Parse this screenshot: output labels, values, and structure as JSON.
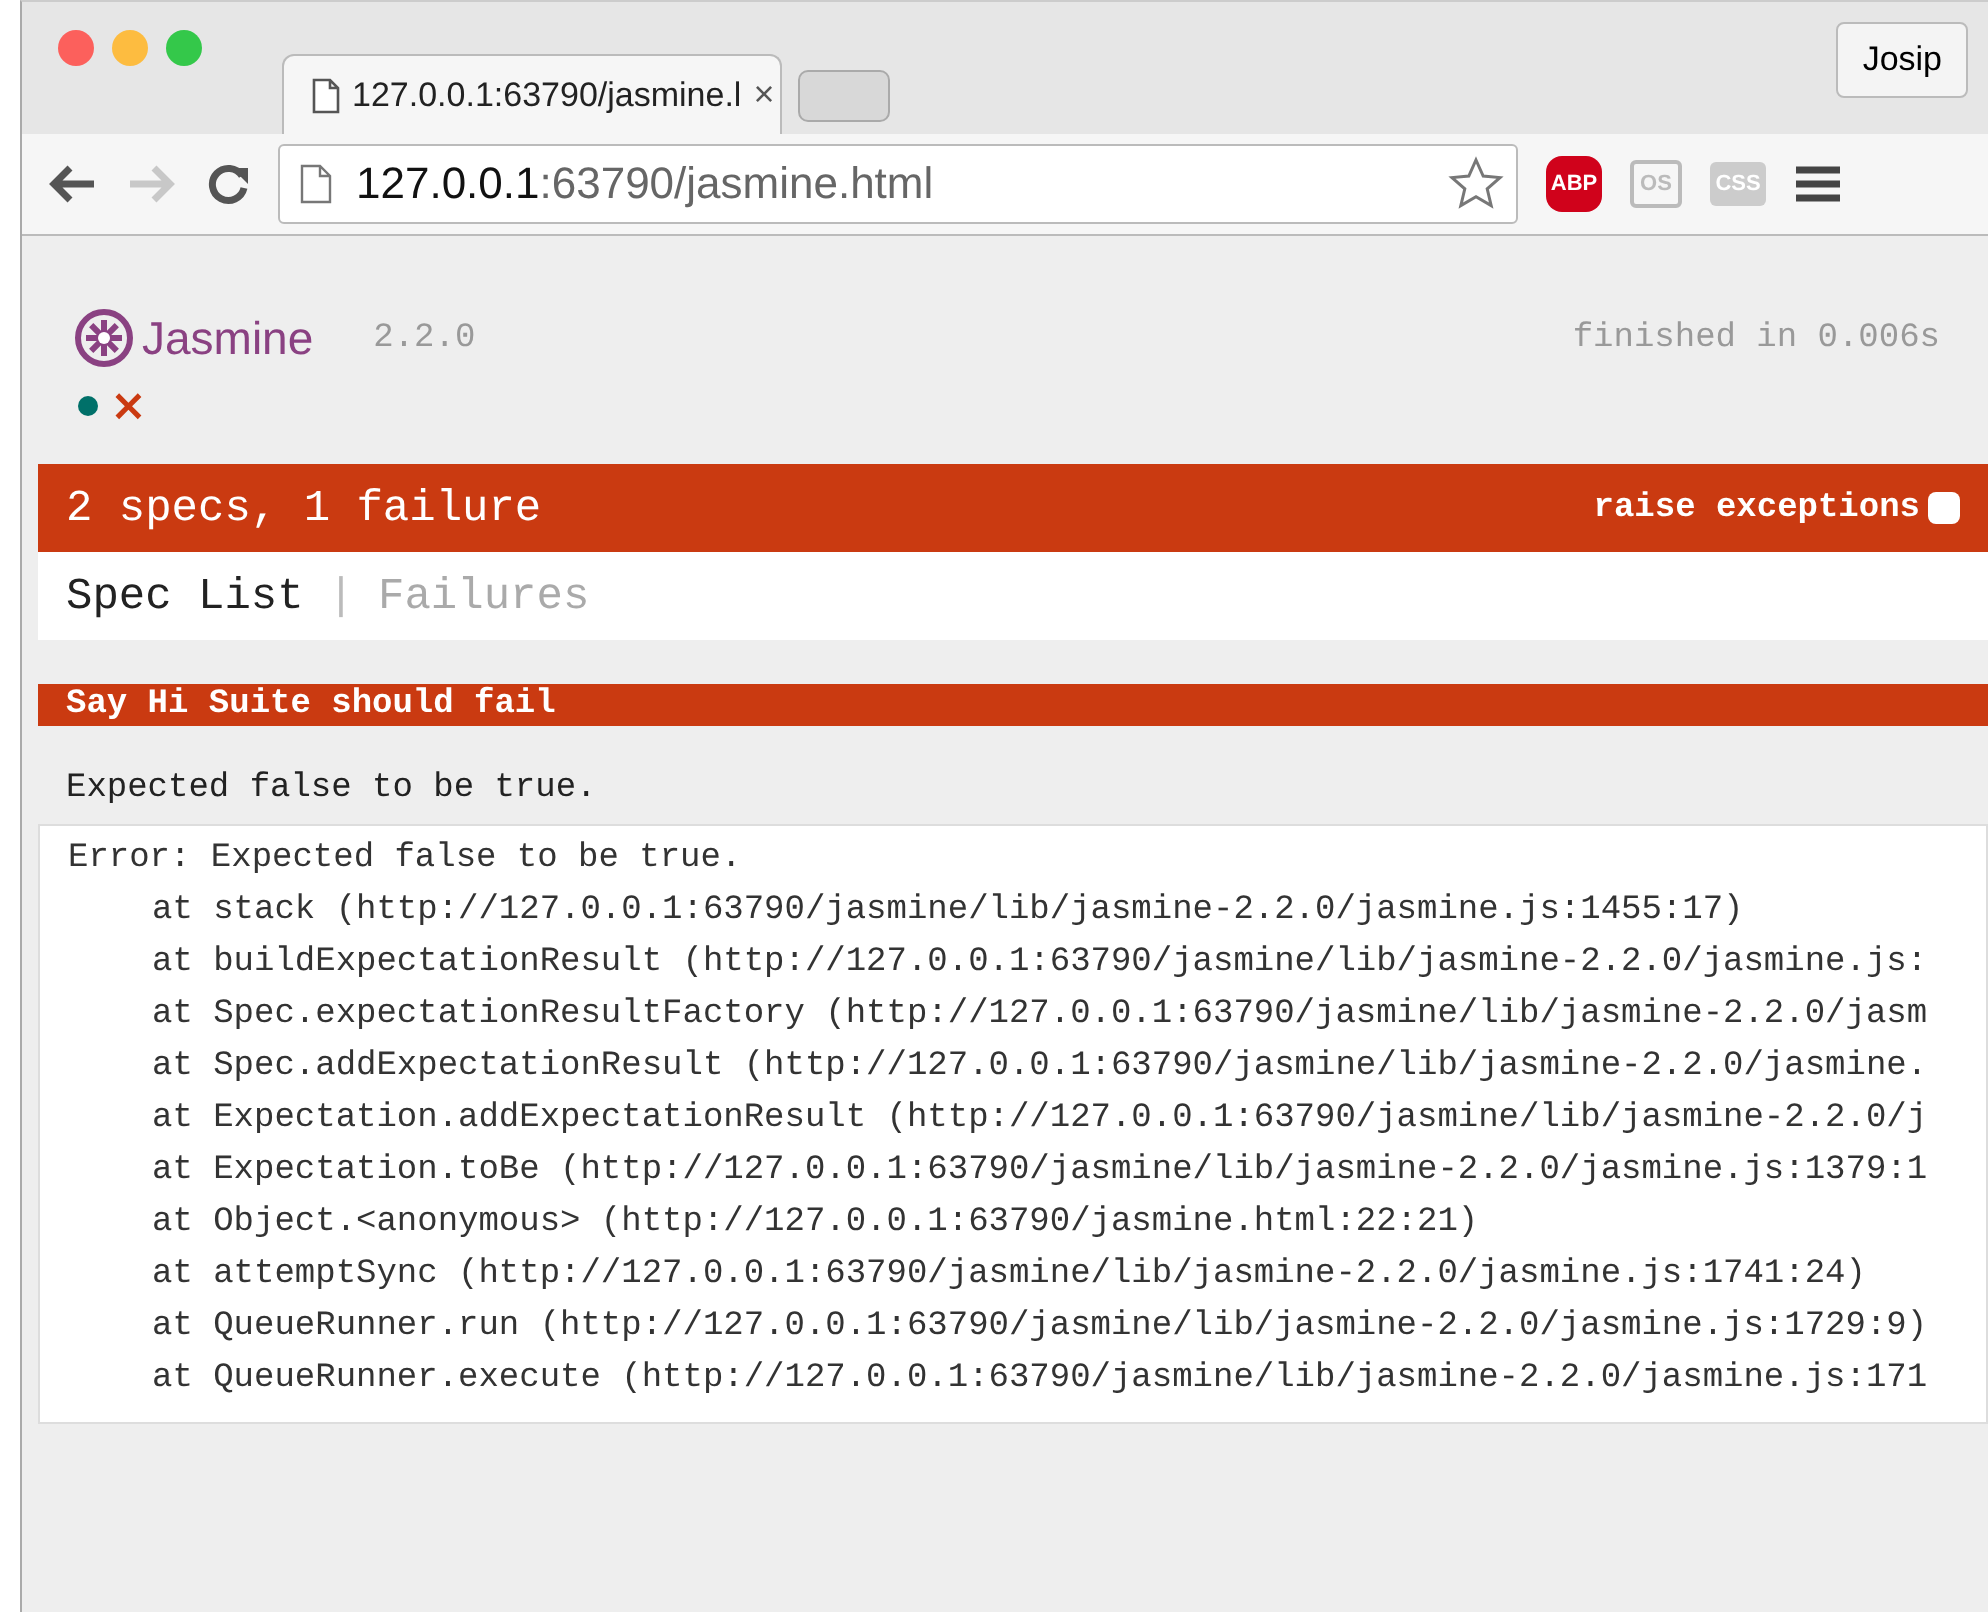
{
  "browser": {
    "tabs": [
      {
        "title": "127.0.0.1:63790/jasmine.l",
        "close": "×",
        "selected": true
      }
    ],
    "profile": "Josip",
    "address": {
      "host": "127.0.0.1",
      "rest": ":63790/jasmine.html"
    },
    "extensions": [
      {
        "kind": "abp",
        "label": "ABP"
      },
      {
        "kind": "box",
        "label": "OS"
      },
      {
        "kind": "css",
        "label": "CSS"
      }
    ]
  },
  "reporter": {
    "brand": "Jasmine",
    "version": "2.2.0",
    "duration": "finished in 0.006s",
    "symbols": [
      {
        "kind": "passed"
      },
      {
        "kind": "failed",
        "glyph": "×"
      }
    ],
    "summary": "2 specs, 1 failure",
    "raise_exceptions": {
      "label": "raise exceptions",
      "checked": false
    },
    "menu": [
      {
        "label": "Spec List",
        "selected": true
      },
      {
        "label": "Failures",
        "selected": false
      }
    ],
    "separator": "|",
    "failures": [
      {
        "title": "Say Hi Suite should fail",
        "message": "Expected false to be true.",
        "stack": [
          "Error: Expected false to be true.",
          "at stack (http://127.0.0.1:63790/jasmine/lib/jasmine-2.2.0/jasmine.js:1455:17)",
          "at buildExpectationResult (http://127.0.0.1:63790/jasmine/lib/jasmine-2.2.0/jasmine.js:",
          "at Spec.expectationResultFactory (http://127.0.0.1:63790/jasmine/lib/jasmine-2.2.0/jasm",
          "at Spec.addExpectationResult (http://127.0.0.1:63790/jasmine/lib/jasmine-2.2.0/jasmine.",
          "at Expectation.addExpectationResult (http://127.0.0.1:63790/jasmine/lib/jasmine-2.2.0/j",
          "at Expectation.toBe (http://127.0.0.1:63790/jasmine/lib/jasmine-2.2.0/jasmine.js:1379:1",
          "at Object.<anonymous> (http://127.0.0.1:63790/jasmine.html:22:21)",
          "at attemptSync (http://127.0.0.1:63790/jasmine/lib/jasmine-2.2.0/jasmine.js:1741:24)",
          "at QueueRunner.run (http://127.0.0.1:63790/jasmine/lib/jasmine-2.2.0/jasmine.js:1729:9)",
          "at QueueRunner.execute (http://127.0.0.1:63790/jasmine/lib/jasmine-2.2.0/jasmine.js:171"
        ]
      }
    ]
  }
}
